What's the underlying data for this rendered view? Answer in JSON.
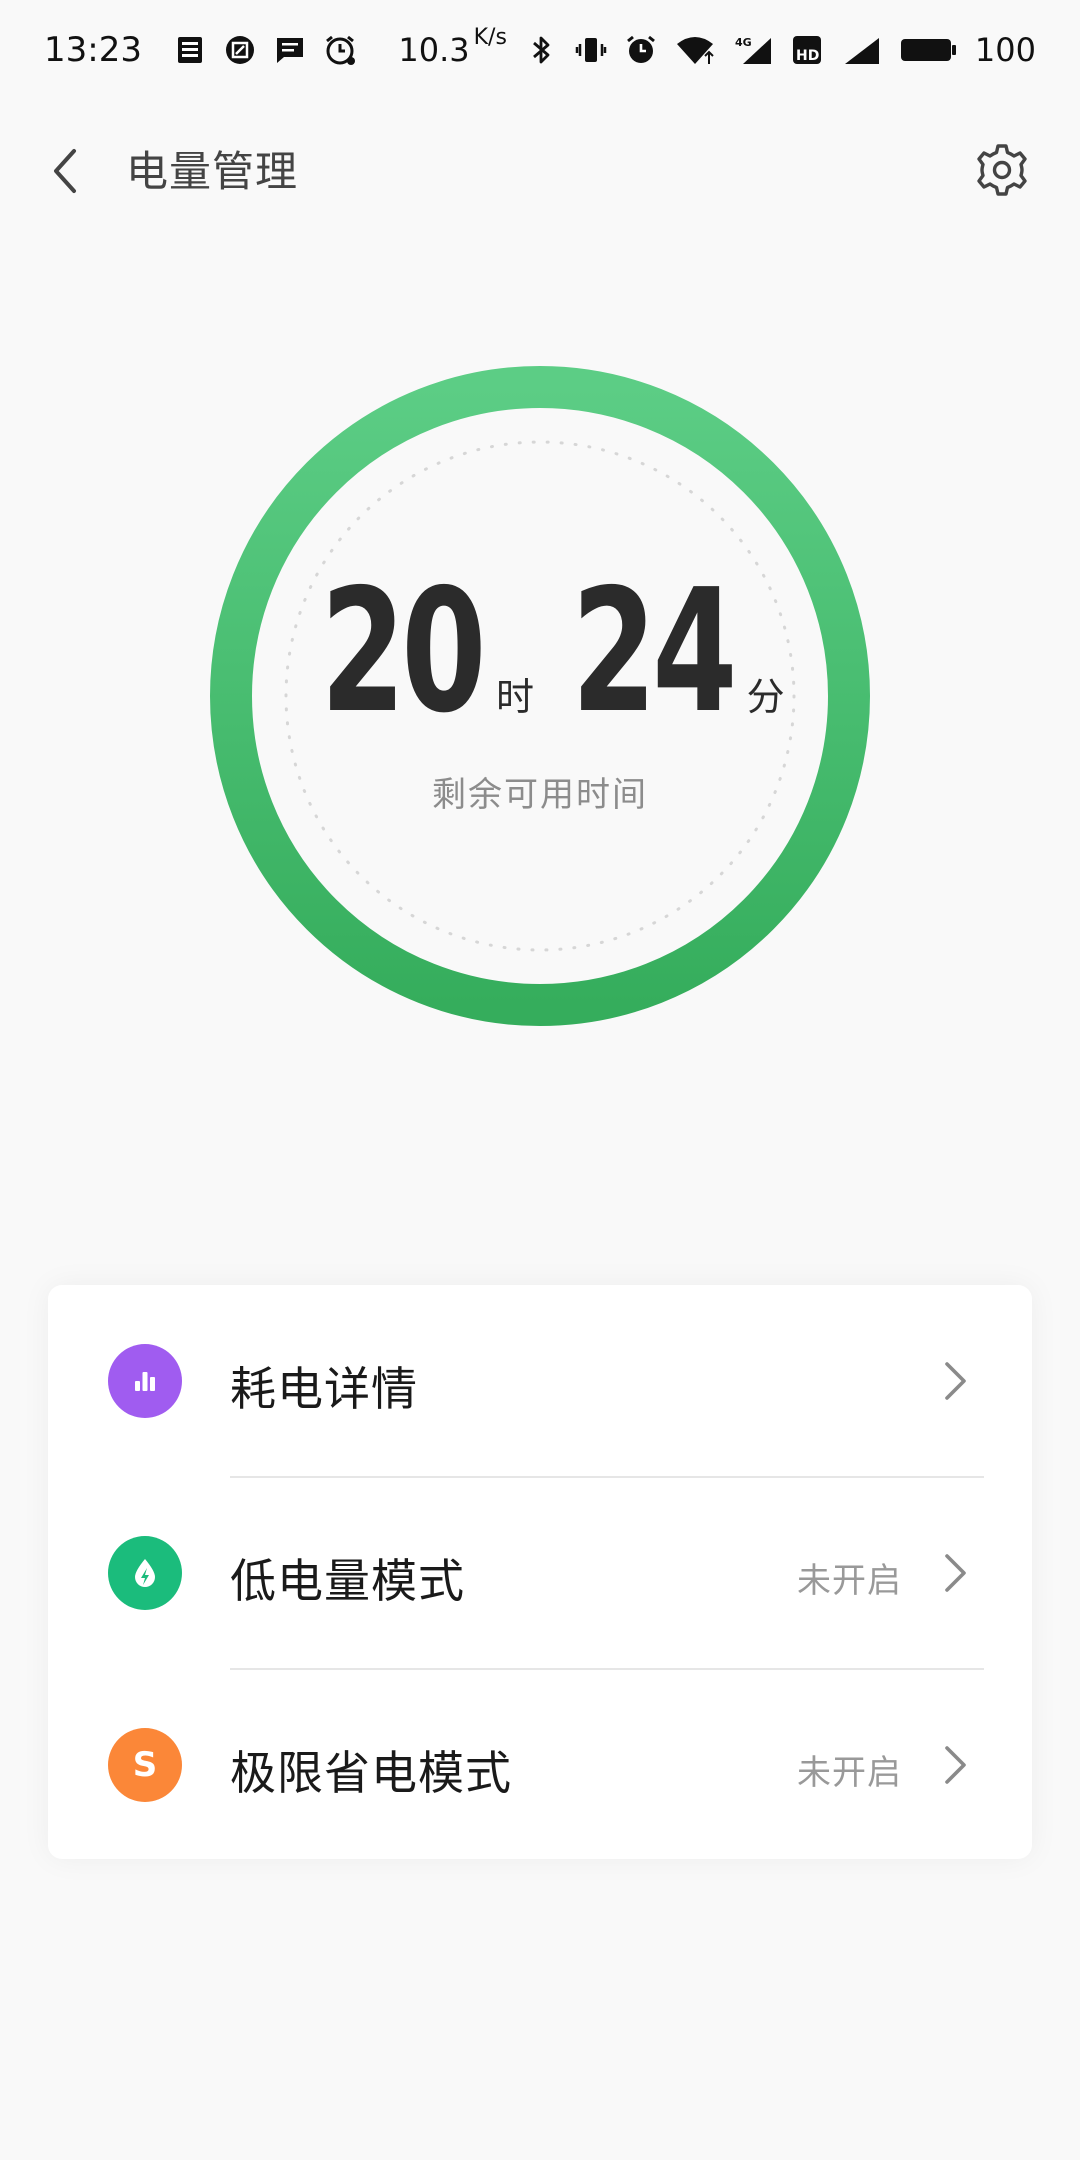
{
  "status_bar": {
    "time": "13:23",
    "net_speed_value": "10.3",
    "net_speed_unit": "K/s",
    "battery_level": "100",
    "left_icons": [
      "news-icon",
      "app-icon",
      "message-icon",
      "alarm-clock-icon"
    ],
    "right_icons": [
      "bluetooth-icon",
      "vibrate-icon",
      "alarm-icon",
      "wifi-icon",
      "4g-signal-icon",
      "hd-icon",
      "signal-icon",
      "battery-icon"
    ]
  },
  "header": {
    "title": "电量管理",
    "back_icon": "chevron-left-icon",
    "settings_icon": "gear-icon"
  },
  "battery_ring": {
    "hours": "20",
    "hours_unit": "时",
    "minutes": "24",
    "minutes_unit": "分",
    "subtitle": "剩余可用时间",
    "colors": {
      "ring_top": "#5ccd85",
      "ring_bottom": "#35ad5c",
      "dots": "#d6d6d6"
    }
  },
  "menu": {
    "items": [
      {
        "label": "耗电详情",
        "status": "",
        "icon": "bar-chart-icon",
        "icon_color": "#a05cf0"
      },
      {
        "label": "低电量模式",
        "status": "未开启",
        "icon": "bolt-drop-icon",
        "icon_color": "#1bbc7c"
      },
      {
        "label": "极限省电模式",
        "status": "未开启",
        "icon": "s-letter-icon",
        "icon_letter": "S",
        "icon_color": "#fb8738"
      }
    ]
  }
}
